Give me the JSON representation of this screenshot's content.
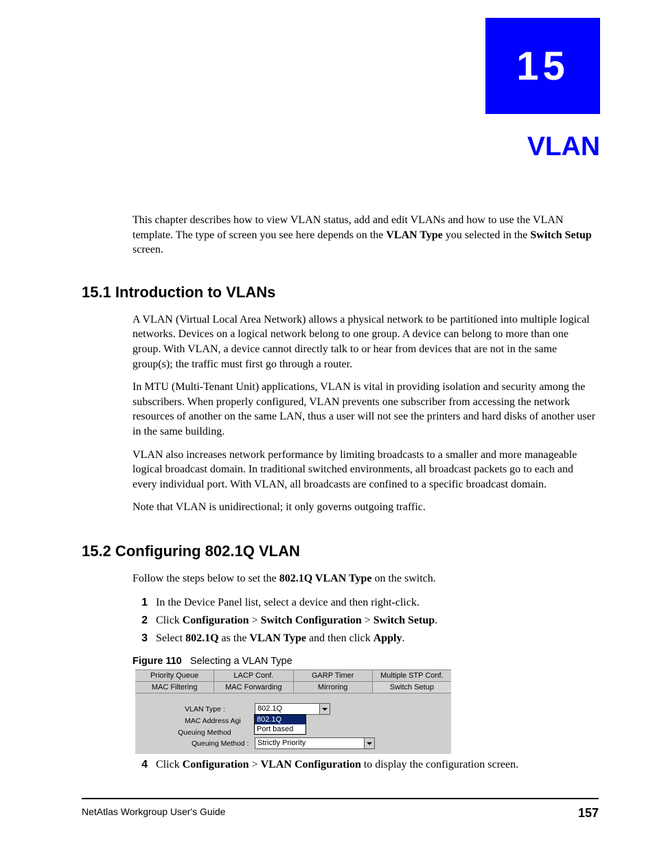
{
  "chapter": {
    "number": "15",
    "title": "VLAN"
  },
  "intro": {
    "t1": "This chapter describes how to view VLAN status, add and edit VLANs and how to use the VLAN template. The type of screen you see here depends on the ",
    "b1": "VLAN Type",
    "t2": " you selected in the ",
    "b2": "Switch Setup",
    "t3": " screen."
  },
  "s1": {
    "heading": "15.1  Introduction to VLANs",
    "p1": "A VLAN (Virtual Local Area Network) allows a physical network to be partitioned into multiple logical networks. Devices on a logical network belong to one group. A device can belong to more than one group. With VLAN, a device cannot directly talk to or hear from devices that are not in the same group(s); the traffic must first go through a router.",
    "p2": "In MTU (Multi-Tenant Unit) applications, VLAN is vital in providing isolation and security among the subscribers. When properly configured, VLAN prevents one subscriber from accessing the network resources of another on the same LAN, thus a user will not see the printers and hard disks of another user in the same building.",
    "p3": "VLAN also increases network performance by limiting broadcasts to a smaller and more manageable logical broadcast domain. In traditional switched environments, all broadcast packets go to each and every individual port. With VLAN, all broadcasts are confined to a specific broadcast domain.",
    "p4": "Note that VLAN is unidirectional; it only governs outgoing traffic."
  },
  "s2": {
    "heading": "15.2  Configuring 802.1Q VLAN",
    "lead_a": "Follow the steps below to set the ",
    "lead_b": "802.1Q VLAN Type",
    "lead_c": " on the switch.",
    "steps": {
      "n1": "1",
      "t1": "In the Device Panel list, select a device and then right-click.",
      "n2": "2",
      "t2a": "Click ",
      "t2b": "Configuration",
      "t2c": " > ",
      "t2d": "Switch Configuration",
      "t2e": " > ",
      "t2f": "Switch Setup",
      "t2g": ".",
      "n3": "3",
      "t3a": "Select ",
      "t3b": "802.1Q",
      "t3c": " as the ",
      "t3d": "VLAN Type",
      "t3e": " and then click ",
      "t3f": "Apply",
      "t3g": ".",
      "n4": "4",
      "t4a": "Click ",
      "t4b": "Configuration",
      "t4c": " > ",
      "t4d": "VLAN Configuration",
      "t4e": " to display the configuration screen."
    }
  },
  "figure": {
    "label": "Figure 110",
    "caption": "Selecting a VLAN Type",
    "tabs_row1": [
      "Priority Queue",
      "LACP Conf.",
      "GARP Timer",
      "Multiple STP Conf."
    ],
    "tabs_row2": [
      "MAC Filtering",
      "MAC Forwarding",
      "Mirroring",
      "Switch Setup"
    ],
    "vlan_type_label": "VLAN Type :",
    "vlan_type_value": "802.1Q",
    "vlan_type_options": [
      "802.1Q",
      "Port based"
    ],
    "mac_aging_label": "MAC Address Agi",
    "queuing_fieldset": "Queuing Method",
    "queuing_label": "Queuing Method :",
    "queuing_value": "Strictly Priority"
  },
  "footer": {
    "guide": "NetAtlas Workgroup User's Guide",
    "page": "157"
  }
}
